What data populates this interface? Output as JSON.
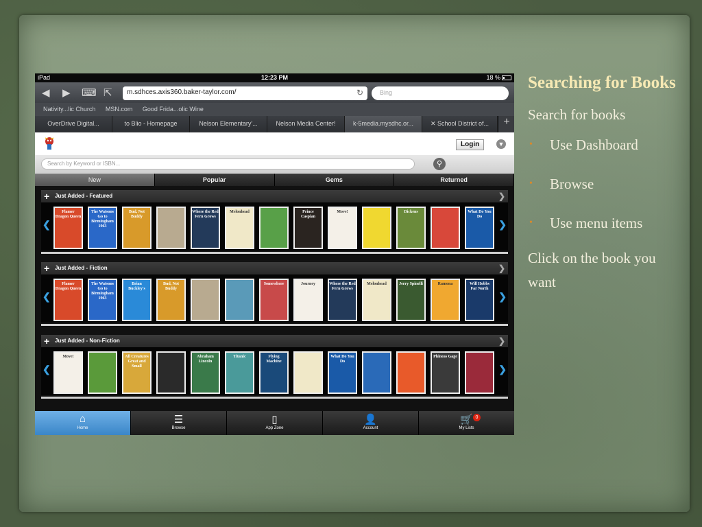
{
  "slide": {
    "title": "Searching for Books",
    "para1": "Search for books",
    "bullets": [
      "Use Dashboard",
      "Browse",
      "Use menu items"
    ],
    "para2": "Click on the book you want"
  },
  "device": {
    "carrier": "iPad",
    "time": "12:23 PM",
    "battery": "18 %"
  },
  "browser": {
    "url": "m.sdhces.axis360.baker-taylor.com/",
    "search_placeholder": "Bing",
    "bookmarks": [
      "Nativity...lic Church",
      "MSN.com",
      "Good Frida...olic Wine"
    ],
    "tabs": [
      {
        "label": "OverDrive Digital...",
        "active": false
      },
      {
        "label": "to Blio - Homepage",
        "active": false
      },
      {
        "label": "Nelson Elementary'...",
        "active": false
      },
      {
        "label": "Nelson Media Center!",
        "active": false
      },
      {
        "label": "k-5media.mysdhc.or...",
        "active": true
      },
      {
        "label": "School District of...",
        "active": false
      }
    ],
    "new_tab": "+"
  },
  "site": {
    "login_label": "Login",
    "search_placeholder": "Search by Keyword or ISBN...",
    "nav": [
      {
        "label": "New",
        "active": true
      },
      {
        "label": "Popular",
        "active": false
      },
      {
        "label": "Gems",
        "active": false
      },
      {
        "label": "Returned",
        "active": false
      }
    ],
    "sections": [
      {
        "title": "Just Added - Featured",
        "covers": [
          {
            "text": "Flamer Dragon Queen",
            "color": "#d84a2a"
          },
          {
            "text": "The Watsons Go to Birmingham 1963",
            "color": "#2a68c8"
          },
          {
            "text": "Bud, Not Buddy",
            "color": "#d89a2a"
          },
          {
            "text": "",
            "color": "#b8aa90"
          },
          {
            "text": "Where the Red Fern Grows",
            "color": "#233a5a"
          },
          {
            "text": "Melonhead",
            "color": "#f0e8c8"
          },
          {
            "text": "",
            "color": "#58a048"
          },
          {
            "text": "Prince Caspian",
            "color": "#2a2420"
          },
          {
            "text": "Move!",
            "color": "#f4f0e8"
          },
          {
            "text": "",
            "color": "#f0d830"
          },
          {
            "text": "Dickens",
            "color": "#6a8a3a"
          },
          {
            "text": "",
            "color": "#d8483a"
          },
          {
            "text": "What Do You Do",
            "color": "#1a5aa8"
          }
        ]
      },
      {
        "title": "Just Added - Fiction",
        "covers": [
          {
            "text": "Flamer Dragon Queen",
            "color": "#d84a2a"
          },
          {
            "text": "The Watsons Go to Birmingham 1963",
            "color": "#2a68c8"
          },
          {
            "text": "Brian Buckley's",
            "color": "#2a8ad8"
          },
          {
            "text": "Bud, Not Buddy",
            "color": "#d89a2a"
          },
          {
            "text": "",
            "color": "#b8aa90"
          },
          {
            "text": "",
            "color": "#5a9ab8"
          },
          {
            "text": "Somewhere",
            "color": "#c84a4a"
          },
          {
            "text": "Journey",
            "color": "#f4f0e8"
          },
          {
            "text": "Where the Red Fern Grows",
            "color": "#233a5a"
          },
          {
            "text": "Melonhead",
            "color": "#f0e8c8"
          },
          {
            "text": "Jerry Spinelli",
            "color": "#3a5a30"
          },
          {
            "text": "Ramona",
            "color": "#f0a830"
          },
          {
            "text": "Will Hobbs Far North",
            "color": "#1a3a6a"
          }
        ]
      },
      {
        "title": "Just Added - Non-Fiction",
        "covers": [
          {
            "text": "Move!",
            "color": "#f4f0e8"
          },
          {
            "text": "",
            "color": "#5a9a3a"
          },
          {
            "text": "All Creatures Great and Small",
            "color": "#d8a83a"
          },
          {
            "text": "",
            "color": "#2a2a2a"
          },
          {
            "text": "Abraham Lincoln",
            "color": "#3a7a4a"
          },
          {
            "text": "Titanic",
            "color": "#4a9a9a"
          },
          {
            "text": "Flying Machine",
            "color": "#1a4a7a"
          },
          {
            "text": "",
            "color": "#f0e8c8"
          },
          {
            "text": "What Do You Do",
            "color": "#1a5aa8"
          },
          {
            "text": "",
            "color": "#2a6ab8"
          },
          {
            "text": "",
            "color": "#e85a2a"
          },
          {
            "text": "Phineas Gage",
            "color": "#3a3a3a"
          },
          {
            "text": "",
            "color": "#9a2a3a"
          }
        ]
      }
    ],
    "bottom_nav": [
      {
        "label": "Home",
        "icon": "home-icon",
        "active": true
      },
      {
        "label": "Browse",
        "icon": "list-icon",
        "active": false
      },
      {
        "label": "App Zone",
        "icon": "tablet-icon",
        "active": false
      },
      {
        "label": "Account",
        "icon": "user-icon",
        "active": false
      },
      {
        "label": "My Lists",
        "icon": "cart-icon",
        "active": false,
        "badge": "0"
      }
    ]
  },
  "colors": {
    "accent_blue": "#3aa0e0",
    "bullet": "#d8892b",
    "title": "#f6e9b4"
  }
}
